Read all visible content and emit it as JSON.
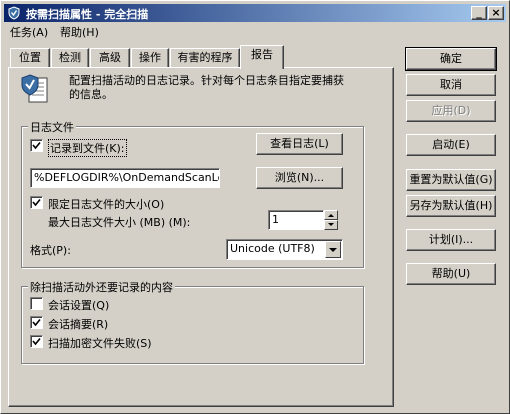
{
  "window": {
    "title": "按需扫描属性 - 完全扫描",
    "buttons": {
      "minimize": "_",
      "close": "×"
    }
  },
  "menu": [
    {
      "label": "任务(A)"
    },
    {
      "label": "帮助(H)"
    }
  ],
  "tabs": [
    {
      "label": "位置"
    },
    {
      "label": "检测"
    },
    {
      "label": "高级"
    },
    {
      "label": "操作"
    },
    {
      "label": "有害的程序"
    },
    {
      "label": "报告",
      "active": true
    }
  ],
  "header": {
    "description_line1": "配置扫描活动的日志记录。针对每个日志条目指定要捕获",
    "description_line2": "的信息。"
  },
  "log_file_group": {
    "title": "日志文件",
    "log_to_file_label": "记录到文件(K):",
    "log_to_file_checked": true,
    "view_log_button": "查看日志(L)",
    "path_value": "%DEFLOGDIR%\\OnDemandScanLog.txt",
    "browse_button": "浏览(N)...",
    "limit_size_label": "限定日志文件的大小(O)",
    "limit_size_checked": true,
    "max_size_label": "最大日志文件大小 (MB) (M):",
    "max_size_value": "1",
    "format_label": "格式(P):",
    "format_value": "Unicode (UTF8)"
  },
  "extra_group": {
    "title": "除扫描活动外还要记录的内容",
    "items": [
      {
        "label": "会话设置(Q)",
        "checked": false
      },
      {
        "label": "会话摘要(R)",
        "checked": true
      },
      {
        "label": "扫描加密文件失败(S)",
        "checked": true
      }
    ]
  },
  "side_buttons": [
    {
      "label": "确定",
      "default": true
    },
    {
      "label": "取消"
    },
    {
      "label": "应用(D)",
      "disabled": true
    },
    {
      "label": "启动(E)"
    },
    {
      "label": "重置为默认值(G)"
    },
    {
      "label": "另存为默认值(H)"
    },
    {
      "label": "计划(I)..."
    },
    {
      "label": "帮助(U)"
    }
  ]
}
